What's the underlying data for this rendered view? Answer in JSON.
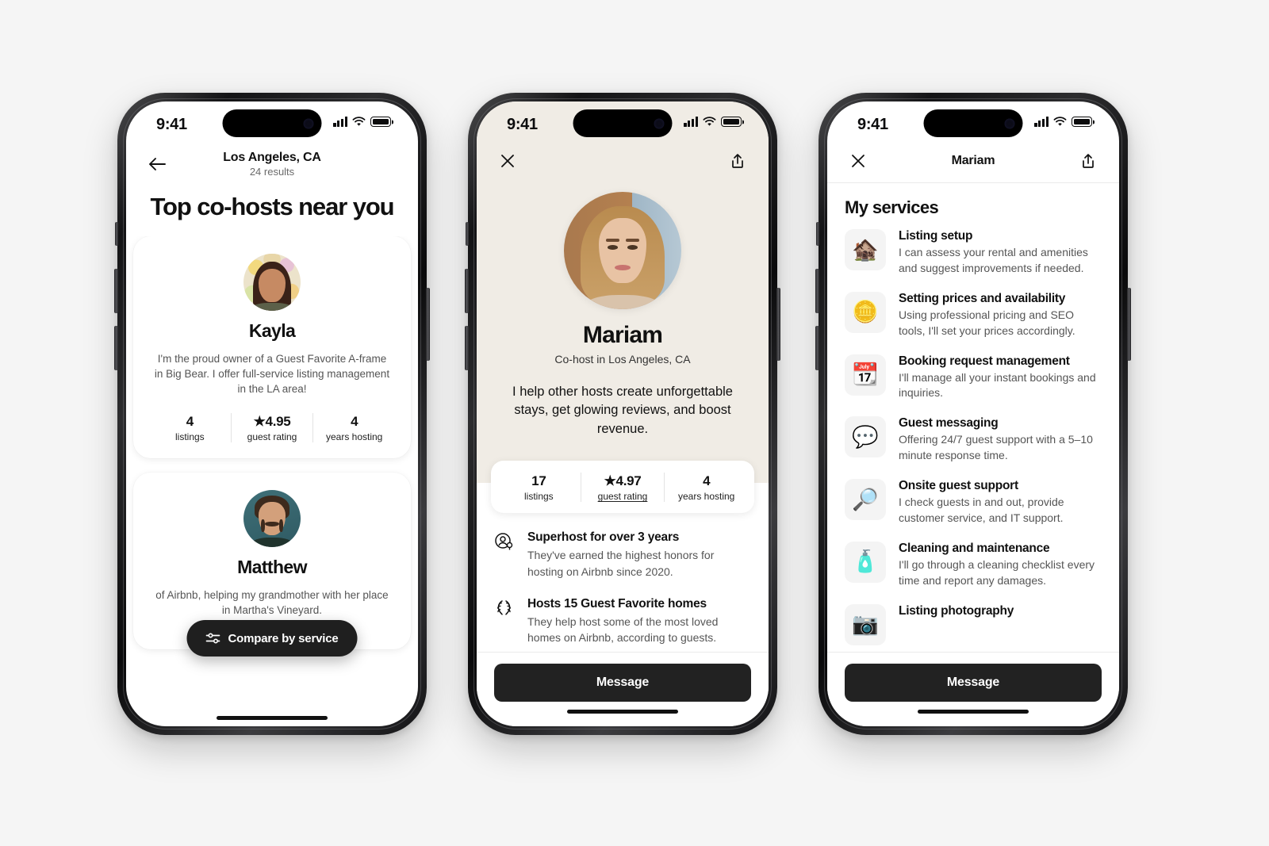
{
  "status_bar": {
    "time": "9:41"
  },
  "phone1": {
    "nav": {
      "back_icon": "arrow-left-icon",
      "title": "Los Angeles, CA",
      "subtitle": "24 results"
    },
    "heading": "Top co-hosts near you",
    "cards": [
      {
        "avatar": "kayla-avatar",
        "name": "Kayla",
        "bio": "I'm the proud owner of a Guest Favorite A-frame in Big Bear. I offer full-service listing management in the LA area!",
        "stats": [
          {
            "value": "4",
            "label": "listings"
          },
          {
            "value": "★4.95",
            "label": "guest rating"
          },
          {
            "value": "4",
            "label": "years hosting"
          }
        ]
      },
      {
        "avatar": "matthew-avatar",
        "name": "Matthew",
        "bio": "of Airbnb, helping my grandmother with her place in Martha's Vineyard.",
        "stats": []
      }
    ],
    "fab": {
      "icon": "tune-filter-icon",
      "label": "Compare by service"
    }
  },
  "phone2": {
    "nav": {
      "close_icon": "close-icon",
      "share_icon": "share-icon"
    },
    "avatar": "mariam-avatar",
    "name": "Mariam",
    "role": "Co-host in Los Angeles, CA",
    "tagline": "I help other hosts create unforgettable stays, get glowing reviews, and boost revenue.",
    "stats": [
      {
        "value": "17",
        "label": "listings",
        "underline": false
      },
      {
        "value": "★4.97",
        "label": "guest rating",
        "underline": true
      },
      {
        "value": "4",
        "label": "years hosting",
        "underline": false
      }
    ],
    "details": [
      {
        "icon": "superhost-badge-icon",
        "title": "Superhost for over 3 years",
        "body": "They've earned the highest honors for hosting on Airbnb since 2020."
      },
      {
        "icon": "guest-favorite-laurel-icon",
        "title": "Hosts 15 Guest Favorite homes",
        "body": "They help host some of the most loved homes on Airbnb, according to guests."
      }
    ],
    "message_button": "Message"
  },
  "phone3": {
    "nav": {
      "close_icon": "close-icon",
      "title": "Mariam",
      "share_icon": "share-icon"
    },
    "section_title": "My services",
    "services": [
      {
        "icon": "house-icon",
        "glyph": "🏚️",
        "title": "Listing setup",
        "body": "I can assess your rental and amenities and suggest improvements if needed."
      },
      {
        "icon": "gold-coin-icon",
        "glyph": "🪙",
        "title": "Setting prices and availability",
        "body": "Using professional pricing and SEO tools, I'll set your prices accordingly."
      },
      {
        "icon": "calendar-icon",
        "glyph": "📆",
        "title": "Booking request management",
        "body": "I'll manage all your instant bookings and inquiries."
      },
      {
        "icon": "speech-bubble-icon",
        "glyph": "💬",
        "title": "Guest messaging",
        "body": "Offering 24/7 guest support with a 5–10 minute response time."
      },
      {
        "icon": "magnifier-key-icon",
        "glyph": "🔎",
        "title": "Onsite guest support",
        "body": "I check guests in and out, provide customer service, and IT support."
      },
      {
        "icon": "spray-bottle-icon",
        "glyph": "🧴",
        "title": "Cleaning and maintenance",
        "body": "I'll go through a cleaning checklist every time and report any damages."
      },
      {
        "icon": "camera-icon",
        "glyph": "📷",
        "title": "Listing photography",
        "body": ""
      }
    ],
    "message_button": "Message"
  },
  "colors": {
    "page_background": "#f5f5f5",
    "beige_hero": "#f0ece5",
    "primary_button": "#222222",
    "pill_background": "#1f1f1f",
    "text_primary": "#111111",
    "text_secondary": "#555555"
  }
}
